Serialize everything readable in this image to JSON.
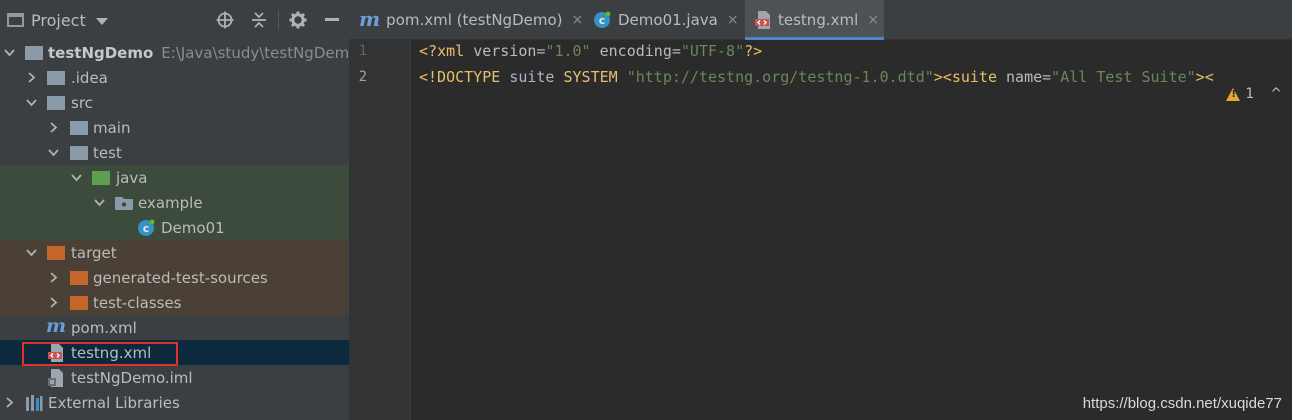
{
  "project_panel": {
    "title": "Project",
    "tree": [
      {
        "label": "testNgDemo",
        "path": "E:\\Java\\study\\testNgDemo"
      },
      {
        "label": ".idea"
      },
      {
        "label": "src"
      },
      {
        "label": "main"
      },
      {
        "label": "test"
      },
      {
        "label": "java"
      },
      {
        "label": "example"
      },
      {
        "label": "Demo01"
      },
      {
        "label": "target"
      },
      {
        "label": "generated-test-sources"
      },
      {
        "label": "test-classes"
      },
      {
        "label": "pom.xml"
      },
      {
        "label": "testng.xml"
      },
      {
        "label": "testNgDemo.iml"
      },
      {
        "label": "External Libraries"
      }
    ]
  },
  "tabs": [
    {
      "label": "pom.xml (testNgDemo)",
      "close": "×"
    },
    {
      "label": "Demo01.java",
      "close": "×"
    },
    {
      "label": "testng.xml",
      "close": "×"
    }
  ],
  "tab_icons": {
    "pom": "m"
  },
  "gutter": {
    "lines": [
      "1",
      "2"
    ]
  },
  "editor": {
    "line1": [
      "<?",
      "xml ",
      "version",
      "=",
      "\"1.0\"",
      " encoding",
      "=",
      "\"UTF-8\"",
      "?>"
    ],
    "line2": [
      "<!DOCTYPE ",
      "suite ",
      "SYSTEM ",
      "\"http://testng.org/testng-1.0.dtd\"",
      "><",
      "suite ",
      "name",
      "=",
      "\"All Test Suite\"",
      ">",
      "<"
    ],
    "warning_count": "1",
    "nav": "^"
  },
  "watermark": "https://blog.csdn.net/xuqide77",
  "colors": {
    "accent": "#4a88c7",
    "selection_outline": "#e0312b",
    "source_folder": "#5d9e4f",
    "excluded_folder": "#c5652b"
  }
}
